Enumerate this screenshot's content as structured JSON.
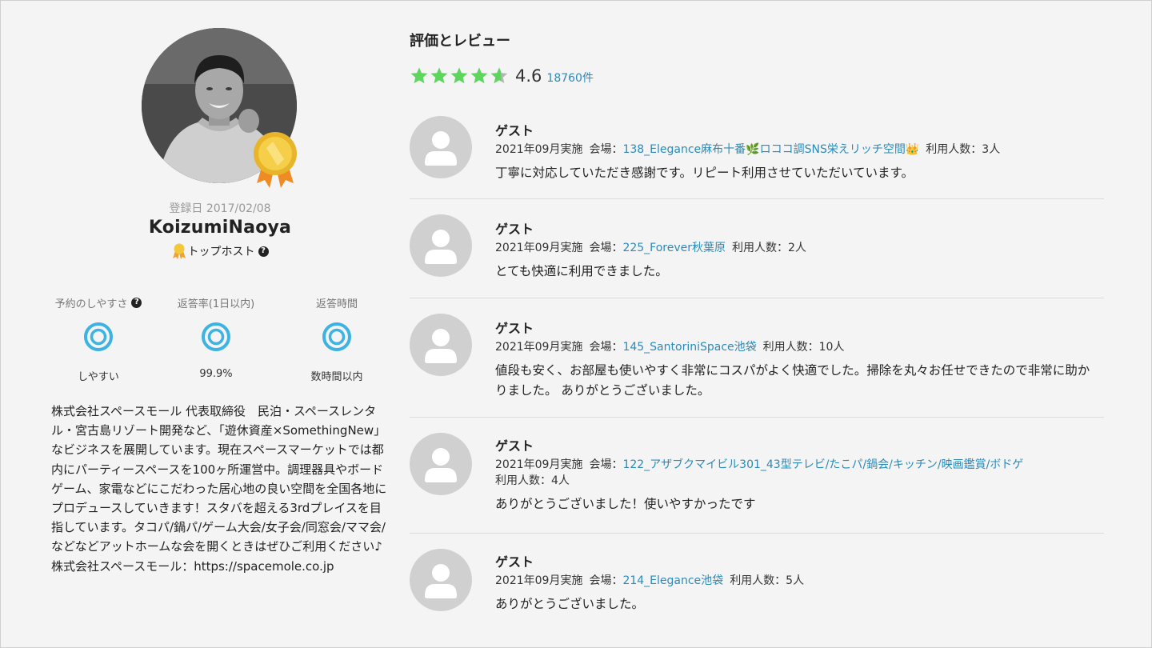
{
  "profile": {
    "registered": "登録日 2017/02/08",
    "name": "KoizumiNaoya",
    "badge_label": "トップホスト",
    "stats": [
      {
        "label": "予約のしやすさ",
        "value": "しやすい",
        "has_help": true
      },
      {
        "label": "返答率(1日以内)",
        "value": "99.9%",
        "has_help": false
      },
      {
        "label": "返答時間",
        "value": "数時間以内",
        "has_help": false
      }
    ],
    "bio": "株式会社スペースモール 代表取締役　民泊・スペースレンタル・宮古島リゾート開発など、「遊休資産×SomethingNew」なビジネスを展開しています。現在スペースマーケットでは都内にパーティースペースを100ヶ所運営中。調理器具やボードゲーム、家電などにこだわった居心地の良い空間を全国各地にプロデュースしていきます！スタバを超える3rdプレイスを目指しています。タコパ/鍋パ/ゲーム大会/女子会/同窓会/ママ会/などなどアットホームな会を開くときはぜひご利用ください♪ 株式会社スペースモール：https://spacemole.co.jp"
  },
  "reviews_section": {
    "title": "評価とレビュー",
    "rating": "4.6",
    "rating_value": 4.6,
    "count": "18760件",
    "star_color": "#5cd65c",
    "star_empty_color": "#b5b5b5",
    "reviews": [
      {
        "name": "ゲスト",
        "date": "2021年09月実施",
        "venue_label": "会場：",
        "venue": "138_Elegance麻布十番🌿ロココ調SNS栄えリッチ空間👑",
        "people": "利用人数：3人",
        "text": "丁寧に対応していただき感謝です。リピート利用させていただいています。"
      },
      {
        "name": "ゲスト",
        "date": "2021年09月実施",
        "venue_label": "会場：",
        "venue": "225_Forever秋葉原",
        "people": "利用人数：2人",
        "text": "とても快適に利用できました。"
      },
      {
        "name": "ゲスト",
        "date": "2021年09月実施",
        "venue_label": "会場：",
        "venue": "145_SantoriniSpace池袋",
        "people": "利用人数：10人",
        "text": "値段も安く、お部屋も使いやすく非常にコスパがよく快適でした。掃除を丸々お任せできたので非常に助かりました。 ありがとうございました。"
      },
      {
        "name": "ゲスト",
        "date": "2021年09月実施",
        "venue_label": "会場：",
        "venue": "122_アザブクマイビル301_43型テレビ/たこパ/鍋会/キッチン/映画鑑賞/ボドゲ",
        "people": "利用人数：4人",
        "text": "ありがとうございました！使いやすかったです"
      },
      {
        "name": "ゲスト",
        "date": "2021年09月実施",
        "venue_label": "会場：",
        "venue": "214_Elegance池袋",
        "people": "利用人数：5人",
        "text": "ありがとうございました。"
      }
    ]
  },
  "colors": {
    "accent_link": "#2b8ab8",
    "ring": "#3db3e3",
    "medal_gold": "#f2c73a",
    "ribbon": "#f08a24"
  },
  "icons": {
    "help": "question-circle-icon",
    "medal": "medal-icon",
    "avatar": "user-silhouette-icon"
  }
}
